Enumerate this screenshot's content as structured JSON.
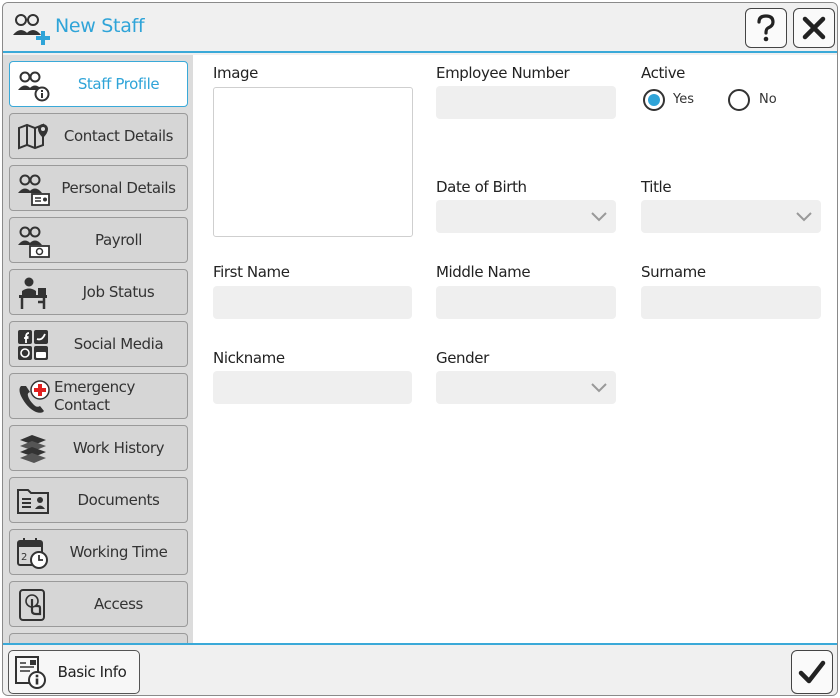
{
  "window": {
    "title": "New Staff",
    "title_icon": "add-staff-icon",
    "help_icon": "question-icon",
    "close_icon": "close-icon",
    "accent_color": "#2fa4d8"
  },
  "sidebar": {
    "items": [
      {
        "label": "Staff Profile",
        "icon": "staff-profile-icon",
        "active": true
      },
      {
        "label": "Contact Details",
        "icon": "map-pin-icon"
      },
      {
        "label": "Personal Details",
        "icon": "personal-id-icon"
      },
      {
        "label": "Payroll",
        "icon": "payroll-icon"
      },
      {
        "label": "Job Status",
        "icon": "desk-worker-icon"
      },
      {
        "label": "Social Media",
        "icon": "social-media-icon"
      },
      {
        "label": "Emergency Contact",
        "icon": "emergency-phone-icon"
      },
      {
        "label": "Work History",
        "icon": "books-icon"
      },
      {
        "label": "Documents",
        "icon": "document-id-icon"
      },
      {
        "label": "Working Time",
        "icon": "calendar-clock-icon"
      },
      {
        "label": "Access",
        "icon": "touch-access-icon"
      }
    ]
  },
  "form": {
    "image_label": "Image",
    "employee_number_label": "Employee Number",
    "employee_number_value": "",
    "active_label": "Active",
    "active_options": [
      "Yes",
      "No"
    ],
    "active_selected": "Yes",
    "dob_label": "Date of Birth",
    "dob_value": "",
    "title_label": "Title",
    "title_value": "",
    "first_name_label": "First Name",
    "first_name_value": "",
    "middle_name_label": "Middle Name",
    "middle_name_value": "",
    "surname_label": "Surname",
    "surname_value": "",
    "nickname_label": "Nickname",
    "nickname_value": "",
    "gender_label": "Gender",
    "gender_value": ""
  },
  "footer": {
    "basic_info_label": "Basic Info",
    "basic_info_icon": "info-document-icon",
    "confirm_icon": "checkmark-icon"
  }
}
